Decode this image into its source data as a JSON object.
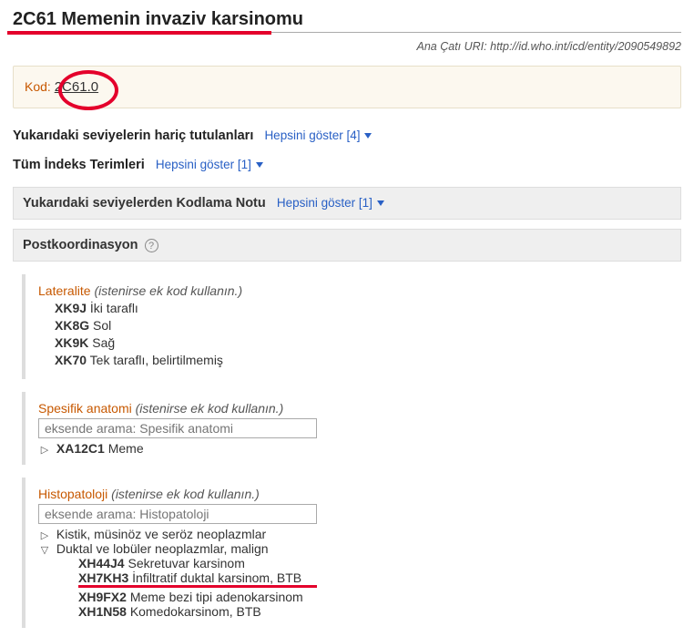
{
  "header": {
    "title": "2C61 Memenin invaziv karsinomu",
    "uri_label": "Ana Çatı URI:",
    "uri": "http://id.who.int/icd/entity/2090549892"
  },
  "code": {
    "label": "Kod:",
    "value": "2C61.0"
  },
  "exclusions": {
    "heading": "Yukarıdaki seviyelerin hariç tutulanları",
    "show_all": "Hepsini göster [4]"
  },
  "index_terms": {
    "heading": "Tüm İndeks Terimleri",
    "show_all": "Hepsini göster [1]"
  },
  "coding_note": {
    "heading": "Yukarıdaki seviyelerden Kodlama Notu",
    "show_all": "Hepsini göster [1]"
  },
  "postcoord": {
    "heading": "Postkoordinasyon"
  },
  "laterality": {
    "title": "Lateralite",
    "hint": "(istenirse ek kod kullanın.)",
    "items": [
      {
        "code": "XK9J",
        "label": "İki taraflı"
      },
      {
        "code": "XK8G",
        "label": "Sol"
      },
      {
        "code": "XK9K",
        "label": "Sağ"
      },
      {
        "code": "XK70",
        "label": "Tek taraflı, belirtilmemiş"
      }
    ]
  },
  "anatomy": {
    "title": "Spesifik anatomi",
    "hint": "(istenirse ek kod kullanın.)",
    "placeholder": "eksende arama: Spesifik anatomi",
    "items": [
      {
        "code": "XA12C1",
        "label": "Meme"
      }
    ]
  },
  "histo": {
    "title": "Histopatoloji",
    "hint": "(istenirse ek kod kullanın.)",
    "placeholder": "eksende arama: Histopatoloji",
    "groups": [
      {
        "label": "Kistik, müsinöz ve seröz neoplazmlar",
        "expanded": false
      },
      {
        "label": "Duktal ve lobüler neoplazmlar, malign",
        "expanded": true,
        "children": [
          {
            "code": "XH44J4",
            "label": "Sekretuvar karsinom"
          },
          {
            "code": "XH7KH3",
            "label": "İnfiltratif duktal karsinom, BTB"
          },
          {
            "code": "XH9FX2",
            "label": "Meme bezi tipi adenokarsinom"
          },
          {
            "code": "XH1N58",
            "label": "Komedokarsinom, BTB"
          }
        ]
      }
    ]
  }
}
